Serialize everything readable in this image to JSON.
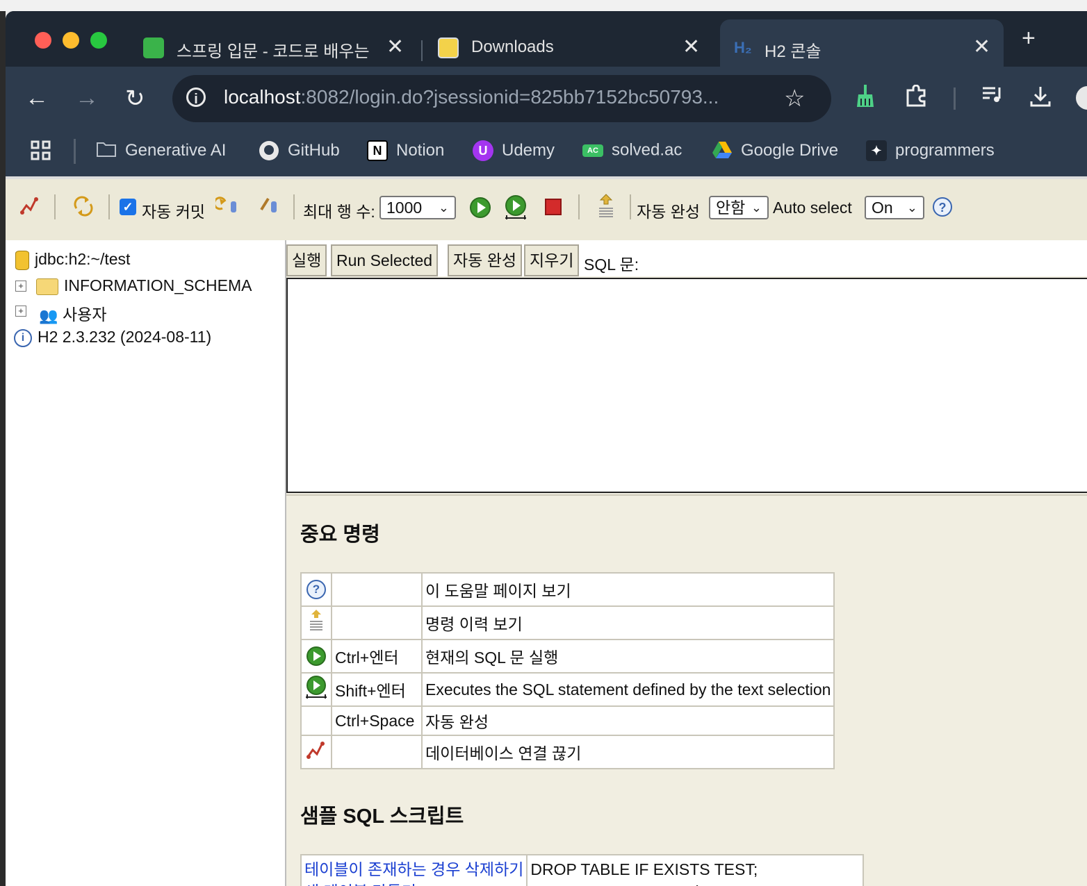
{
  "browser": {
    "tabs": [
      {
        "title": "스프링 입문 - 코드로 배우는 스",
        "favicon": "spring-course-favicon"
      },
      {
        "title": "Downloads",
        "favicon": "file-favicon"
      },
      {
        "title": "H2 콘솔",
        "favicon": "h2-favicon",
        "active": true
      }
    ],
    "url_host": "localhost",
    "url_rest": ":8082/login.do?jsessionid=825bb7152bc50793...",
    "bookmarks": [
      {
        "label": "Generative AI",
        "icon": "folder-icon"
      },
      {
        "label": "GitHub",
        "icon": "github-icon"
      },
      {
        "label": "Notion",
        "icon": "notion-icon"
      },
      {
        "label": "Udemy",
        "icon": "udemy-icon"
      },
      {
        "label": "solved.ac",
        "icon": "solvedac-icon"
      },
      {
        "label": "Google Drive",
        "icon": "google-drive-icon"
      },
      {
        "label": "programmers",
        "icon": "programmers-icon"
      }
    ]
  },
  "h2toolbar": {
    "autocommit_label": "자동 커밋",
    "autocommit_checked": true,
    "maxrows_label": "최대 행 수:",
    "maxrows_value": "1000",
    "autocomplete_label": "자동 완성",
    "autocomplete_value": "안함",
    "autoselect_label": "Auto select",
    "autoselect_value": "On"
  },
  "tree": {
    "connection": "jdbc:h2:~/test",
    "nodes": [
      {
        "label": "INFORMATION_SCHEMA",
        "icon": "folder-icon"
      },
      {
        "label": "사용자",
        "icon": "users-icon"
      }
    ],
    "version": "H2 2.3.232 (2024-08-11)"
  },
  "sql": {
    "buttons": {
      "run": "실행",
      "run_selected": "Run Selected",
      "autocomplete": "자동 완성",
      "clear": "지우기"
    },
    "label": "SQL 문:",
    "text": ""
  },
  "help": {
    "important_title": "중요 명령",
    "commands": [
      {
        "icon": "help-icon",
        "keys": "",
        "desc": "이 도움말 페이지 보기"
      },
      {
        "icon": "history-icon",
        "keys": "",
        "desc": "명령 이력 보기"
      },
      {
        "icon": "run-icon",
        "keys": "Ctrl+엔터",
        "desc": "현재의 SQL 문 실행"
      },
      {
        "icon": "run-selected-icon",
        "keys": "Shift+엔터",
        "desc": "Executes the SQL statement defined by the text selection"
      },
      {
        "icon": "",
        "keys": "Ctrl+Space",
        "desc": "자동 완성"
      },
      {
        "icon": "disconnect-icon",
        "keys": "",
        "desc": "데이터베이스 연결 끊기"
      }
    ],
    "sample_title": "샘플 SQL 스크립트",
    "samples": [
      {
        "link": "테이블이 존재하는 경우 삭제하기",
        "code": "DROP TABLE IF EXISTS TEST;"
      },
      {
        "link": "새 테이블 만들기",
        "code": "CREATE TABLE TEST(ID INT PRIMARY KEY,"
      }
    ]
  }
}
